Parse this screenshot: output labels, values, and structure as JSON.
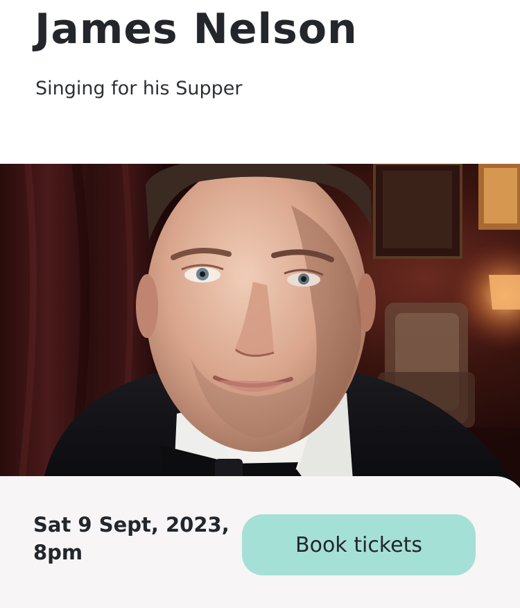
{
  "event": {
    "title": "James Nelson",
    "subtitle": "Singing for his Supper",
    "date": "Sat 9 Sept, 2023, 8pm",
    "book_label": "Book tickets"
  },
  "colors": {
    "title_text": "#23262b",
    "footer_background": "#f7f5f5",
    "button_background": "#a5e0d6"
  }
}
